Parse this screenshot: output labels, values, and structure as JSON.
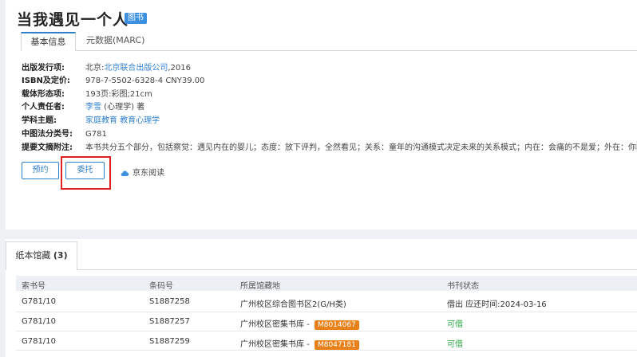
{
  "book": {
    "title": "当我遇见一个人",
    "type_badge": "图书"
  },
  "tabs": [
    {
      "label": "基本信息",
      "active": true
    },
    {
      "label": "元数据(MARC)",
      "active": false
    }
  ],
  "details": {
    "publisher": {
      "label": "出版发行项:",
      "city": "北京:",
      "name": "北京联合出版公司",
      "year": ",2016"
    },
    "isbn": {
      "label": "ISBN及定价:",
      "value": "978-7-5502-6328-4 CNY39.00"
    },
    "physical": {
      "label": "载体形态项:",
      "value": "193页:彩图;21cm"
    },
    "author": {
      "label": "个人责任者:",
      "name": "李雪",
      "suffix": " (心理学) 著"
    },
    "subject": {
      "label": "学科主题:",
      "items": [
        "家庭教育",
        "教育心理学"
      ]
    },
    "clc": {
      "label": "中图法分类号:",
      "value": "G781"
    },
    "abstract": {
      "label": "提要文摘附注:",
      "value": "本书共分五个部分，包括察觉：遇见内在的婴儿；态度：放下评判，全然看见；关系：童年的沟通模式决定未来的关系模式；内在：会痛的不是爱；外在：你配得起"
    }
  },
  "actions": {
    "reserve": "预约",
    "entrust": "委托",
    "jd_read": "京东阅读"
  },
  "holdings": {
    "tab_label": "纸本馆藏",
    "count": "(3)",
    "columns": [
      "索书号",
      "条码号",
      "所属馆藏地",
      "书刊状态"
    ],
    "rows": [
      {
        "call_no": "G781/10",
        "barcode": "S1887258",
        "location": "广州校区综合图书区2(G/H类)",
        "tag": "",
        "status": "借出 应还时间:2024-03-16",
        "status_color": "#333333"
      },
      {
        "call_no": "G781/10",
        "barcode": "S1887257",
        "location": "广州校区密集书库 - ",
        "tag": "M8014067",
        "status": "可借",
        "status_color": "#27a844"
      },
      {
        "call_no": "G781/10",
        "barcode": "S1887259",
        "location": "广州校区密集书库 - ",
        "tag": "M8047181",
        "status": "可借",
        "status_color": "#27a844"
      }
    ]
  },
  "colors": {
    "accent": "#2f7fcf",
    "badge": "#3d8fe0",
    "tag": "#e8811a",
    "highlight": "#e02020",
    "available": "#27a844"
  }
}
